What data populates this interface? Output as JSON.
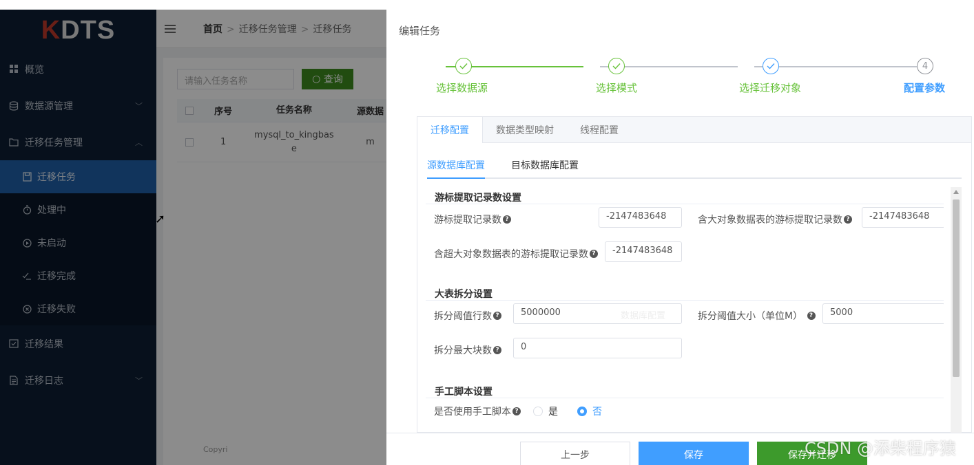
{
  "sidebar": {
    "logo_k": "K",
    "logo_rest": "DTS",
    "items": [
      {
        "label": "概览",
        "icon": "grid-icon"
      },
      {
        "label": "数据源管理",
        "icon": "database-icon"
      },
      {
        "label": "迁移任务管理",
        "icon": "folder-icon"
      },
      {
        "label": "迁移结果",
        "icon": "result-icon"
      },
      {
        "label": "迁移日志",
        "icon": "log-icon"
      }
    ],
    "subitems": [
      {
        "label": "迁移任务",
        "icon": "task-icon",
        "active": true
      },
      {
        "label": "处理中",
        "icon": "timer-icon"
      },
      {
        "label": "未启动",
        "icon": "play-circle-icon"
      },
      {
        "label": "迁移完成",
        "icon": "check-list-icon"
      },
      {
        "label": "迁移失败",
        "icon": "x-circle-icon"
      }
    ]
  },
  "main": {
    "breadcrumb": {
      "home": "首页",
      "level1": "迁移任务管理",
      "level2": "迁移任务"
    },
    "search": {
      "placeholder": "请输入任务名称",
      "button": "查询"
    },
    "table": {
      "headers": [
        "序号",
        "任务名称",
        "源数据"
      ],
      "rows": [
        {
          "index": "1",
          "name_line1": "mysql_to_kingbas",
          "name_line2": "e",
          "source": "m"
        }
      ]
    },
    "footer": "Copyri"
  },
  "drawer": {
    "title": "编辑任务",
    "steps": [
      {
        "label": "选择数据源",
        "status": "done"
      },
      {
        "label": "选择模式",
        "status": "done"
      },
      {
        "label": "选择迁移对象",
        "status": "current-done"
      },
      {
        "label": "配置参数",
        "status": "active",
        "number": "4"
      }
    ],
    "tabs": [
      "迁移配置",
      "数据类型映射",
      "线程配置"
    ],
    "subtabs": [
      "源数据库配置",
      "目标数据库配置"
    ],
    "sections": {
      "cursor": {
        "title": "游标提取记录数设置",
        "fetch_label": "游标提取记录数",
        "fetch_value": "-2147483648",
        "lob_label": "含大对象数据表的游标提取记录数",
        "lob_value": "-2147483648",
        "biglob_label": "含超大对象数据表的游标提取记录数",
        "biglob_value": "-2147483648"
      },
      "split": {
        "title": "大表拆分设置",
        "rows_label": "拆分阈值行数",
        "rows_value": "5000000",
        "size_label": "拆分阈值大小（单位M）",
        "size_value": "5000",
        "blocks_label": "拆分最大块数",
        "blocks_value": "0"
      },
      "script": {
        "title": "手工脚本设置",
        "use_label": "是否使用手工脚本",
        "yes": "是",
        "no": "否",
        "selected": "否"
      }
    },
    "ghost_text": "数据库配置",
    "buttons": {
      "prev": "上一步",
      "save": "保存",
      "save_migrate": "保存并迁移"
    }
  },
  "watermark": "CSDN @添柴程序猿",
  "colors": {
    "primary": "#409eff",
    "success": "#67c23a",
    "sidebar_bg": "#0d1e33",
    "active_nav": "#1f5fa8"
  }
}
